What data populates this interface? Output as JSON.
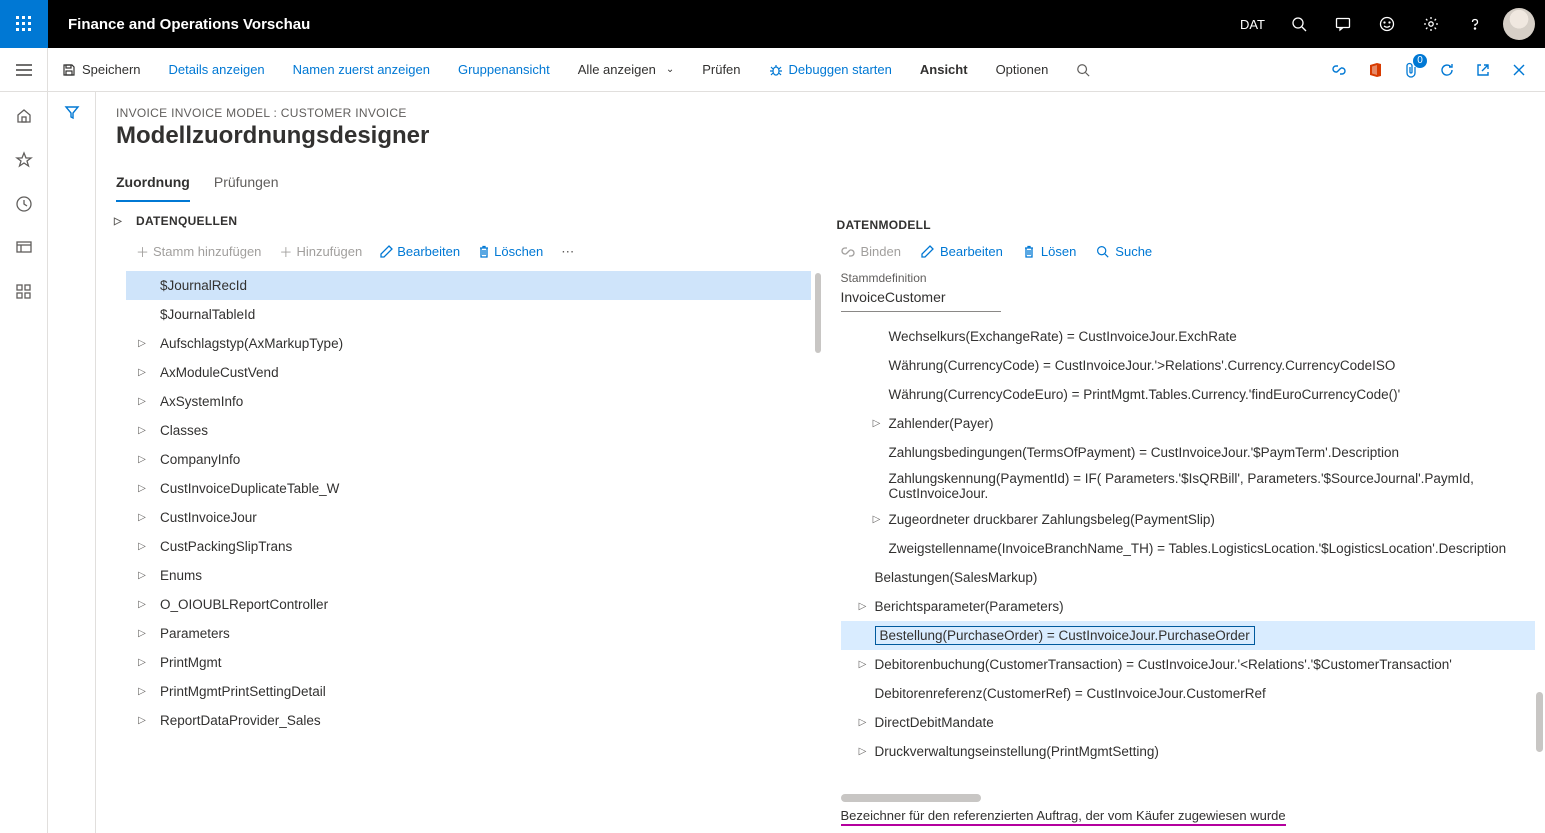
{
  "topbar": {
    "title": "Finance and Operations Vorschau",
    "company": "DAT"
  },
  "cmdbar": {
    "save": "Speichern",
    "details": "Details anzeigen",
    "names": "Namen zuerst anzeigen",
    "group": "Gruppenansicht",
    "showall": "Alle anzeigen",
    "check": "Prüfen",
    "debug": "Debuggen starten",
    "view": "Ansicht",
    "options": "Optionen",
    "badge": "0"
  },
  "page": {
    "breadcrumb": "INVOICE INVOICE MODEL : CUSTOMER INVOICE",
    "title": "Modellzuordnungsdesigner"
  },
  "tabs": {
    "mapping": "Zuordnung",
    "checks": "Prüfungen"
  },
  "ds": {
    "header": "DATENQUELLEN",
    "addRoot": "Stamm hinzufügen",
    "add": "Hinzufügen",
    "edit": "Bearbeiten",
    "delete": "Löschen",
    "items": [
      {
        "label": "$JournalRecId",
        "expandable": false,
        "selected": true
      },
      {
        "label": "$JournalTableId",
        "expandable": false
      },
      {
        "label": "Aufschlagstyp(AxMarkupType)",
        "expandable": true
      },
      {
        "label": "AxModuleCustVend",
        "expandable": true
      },
      {
        "label": "AxSystemInfo",
        "expandable": true
      },
      {
        "label": "Classes",
        "expandable": true
      },
      {
        "label": "CompanyInfo",
        "expandable": true
      },
      {
        "label": "CustInvoiceDuplicateTable_W",
        "expandable": true
      },
      {
        "label": "CustInvoiceJour",
        "expandable": true
      },
      {
        "label": "CustPackingSlipTrans",
        "expandable": true
      },
      {
        "label": "Enums",
        "expandable": true
      },
      {
        "label": "O_OIOUBLReportController",
        "expandable": true
      },
      {
        "label": "Parameters",
        "expandable": true
      },
      {
        "label": "PrintMgmt",
        "expandable": true
      },
      {
        "label": "PrintMgmtPrintSettingDetail",
        "expandable": true
      },
      {
        "label": "ReportDataProvider_Sales",
        "expandable": true
      }
    ]
  },
  "dm": {
    "header": "DATENMODELL",
    "bind": "Binden",
    "edit": "Bearbeiten",
    "unbind": "Lösen",
    "search": "Suche",
    "stammLabel": "Stammdefinition",
    "stammValue": "InvoiceCustomer",
    "rows": [
      {
        "text": "Wechselkurs(ExchangeRate) = CustInvoiceJour.ExchRate",
        "exp": "",
        "ind": 1
      },
      {
        "text": "Währung(CurrencyCode) = CustInvoiceJour.'>Relations'.Currency.CurrencyCodeISO",
        "exp": "",
        "ind": 1
      },
      {
        "text": "Währung(CurrencyCodeEuro) = PrintMgmt.Tables.Currency.'findEuroCurrencyCode()'",
        "exp": "",
        "ind": 1
      },
      {
        "text": "Zahlender(Payer)",
        "exp": "▷",
        "ind": 1
      },
      {
        "text": "Zahlungsbedingungen(TermsOfPayment) = CustInvoiceJour.'$PaymTerm'.Description",
        "exp": "",
        "ind": 1
      },
      {
        "text": "Zahlungskennung(PaymentId) = IF( Parameters.'$IsQRBill', Parameters.'$SourceJournal'.PaymId, CustInvoiceJour.",
        "exp": "",
        "ind": 1
      },
      {
        "text": "Zugeordneter druckbarer Zahlungsbeleg(PaymentSlip)",
        "exp": "▷",
        "ind": 1
      },
      {
        "text": "Zweigstellenname(InvoiceBranchName_TH) = Tables.LogisticsLocation.'$LogisticsLocation'.Description",
        "exp": "",
        "ind": 1
      },
      {
        "text": "Belastungen(SalesMarkup)",
        "exp": "",
        "ind": 0
      },
      {
        "text": "Berichtsparameter(Parameters)",
        "exp": "▷",
        "ind": 0
      },
      {
        "text": "Bestellung(PurchaseOrder) = CustInvoiceJour.PurchaseOrder",
        "exp": "",
        "ind": 0,
        "sel": true
      },
      {
        "text": "Debitorenbuchung(CustomerTransaction) = CustInvoiceJour.'<Relations'.'$CustomerTransaction'",
        "exp": "▷",
        "ind": 0
      },
      {
        "text": "Debitorenreferenz(CustomerRef) = CustInvoiceJour.CustomerRef",
        "exp": "",
        "ind": 0
      },
      {
        "text": "DirectDebitMandate",
        "exp": "▷",
        "ind": 0
      },
      {
        "text": "Druckverwaltungseinstellung(PrintMgmtSetting)",
        "exp": "▷",
        "ind": 0
      }
    ],
    "footer": "Bezeichner für den referenzierten Auftrag, der vom Käufer zugewiesen wurde"
  }
}
